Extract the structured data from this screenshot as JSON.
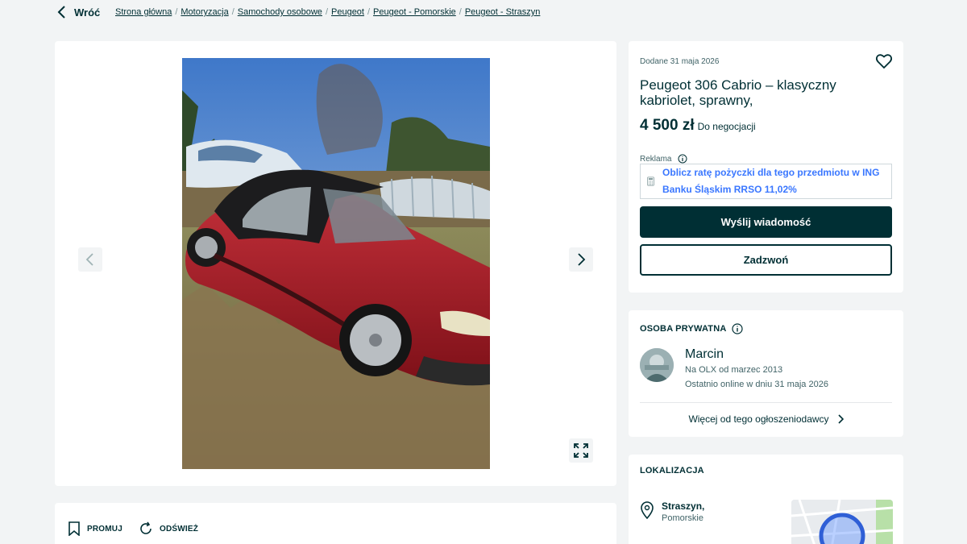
{
  "nav": {
    "back_label": "Wróć",
    "breadcrumbs": [
      "Strona główna",
      "Motoryzacja",
      "Samochody osobowe",
      "Peugeot",
      "Peugeot - Pomorskie",
      "Peugeot - Straszyn"
    ]
  },
  "gallery": {
    "photo_subject": "Red Peugeot 306 Cabrio with black soft top parked on dry grass"
  },
  "actions": {
    "promote_label": "PROMUJ",
    "refresh_label": "ODŚWIEŻ"
  },
  "offer": {
    "added": "Dodane 31 maja 2026",
    "title": "Peugeot 306 Cabrio – klasyczny kabriolet, sprawny,",
    "price": "4 500 zł",
    "negotiable": "Do negocjacji",
    "ad_label": "Reklama",
    "loan_text": "Oblicz ratę pożyczki dla tego przedmiotu w ING Banku Śląskim RRSO 11,02%",
    "message_button": "Wyślij wiadomość",
    "call_button": "Zadzwoń"
  },
  "seller": {
    "type": "OSOBA PRYWATNA",
    "name": "Marcin",
    "since": "Na OLX od marzec 2013",
    "last_online": "Ostatnio online w dniu 31 maja 2026",
    "more_link": "Więcej od tego ogłoszeniodawcy"
  },
  "location": {
    "label": "LOKALIZACJA",
    "city": "Straszyn,",
    "region": "Pomorskie"
  },
  "colors": {
    "primary": "#002f34",
    "link_blue": "#3a77ff",
    "background": "#f2f4f5"
  }
}
